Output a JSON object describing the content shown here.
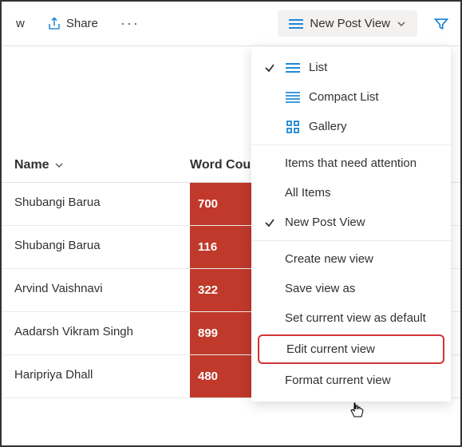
{
  "toolbar": {
    "truncated_item": "w",
    "share_label": "Share",
    "view_dropdown_label": "New Post View"
  },
  "columns": {
    "name": "Name",
    "word_count": "Word Cou"
  },
  "rows": [
    {
      "name": "Shubangi Barua",
      "wc": "700"
    },
    {
      "name": "Shubangi Barua",
      "wc": "116"
    },
    {
      "name": "Arvind Vaishnavi",
      "wc": "322"
    },
    {
      "name": "Aadarsh Vikram Singh",
      "wc": "899"
    },
    {
      "name": "Haripriya Dhall",
      "wc": "480"
    }
  ],
  "menu": {
    "list": "List",
    "compact": "Compact List",
    "gallery": "Gallery",
    "attention": "Items that need attention",
    "all_items": "All Items",
    "new_post_view": "New Post View",
    "create": "Create new view",
    "save_as": "Save view as",
    "set_default": "Set current view as default",
    "edit": "Edit current view",
    "format": "Format current view"
  }
}
